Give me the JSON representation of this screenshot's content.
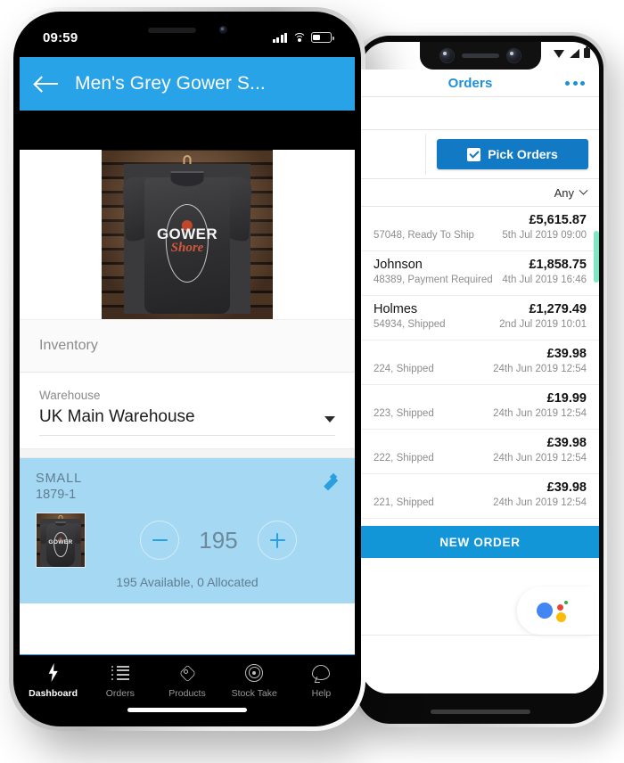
{
  "front_phone": {
    "status_bar": {
      "clock": "09:59",
      "signal": "signal-bars",
      "wifi": "wifi-icon",
      "battery": "battery-icon"
    },
    "header": {
      "back": "back-arrow",
      "title": "Men's Grey Gower S..."
    },
    "product_image": {
      "alt": "Men's Grey Gower Shore T-Shirt on hanger against wooden planks",
      "graphic_word": "GOWER",
      "graphic_script": "Shore"
    },
    "inventory": {
      "section_label": "Inventory"
    },
    "warehouse": {
      "caption": "Warehouse",
      "value": "UK Main Warehouse",
      "chevron": "chevron-down-icon"
    },
    "stock_card": {
      "size": "SMALL",
      "sku": "1879-1",
      "edit": "edit-pencil-icon",
      "decrement": "minus-icon",
      "quantity": "195",
      "increment": "plus-icon",
      "availability": "195 Available, 0 Allocated",
      "bg_color": "#a5d8f3"
    },
    "tabbar": {
      "items": [
        {
          "label": "Dashboard",
          "icon": "bolt-icon",
          "active": true
        },
        {
          "label": "Orders",
          "icon": "list-icon",
          "active": false
        },
        {
          "label": "Products",
          "icon": "tag-icon",
          "active": false
        },
        {
          "label": "Stock Take",
          "icon": "target-icon",
          "active": false
        },
        {
          "label": "Help",
          "icon": "chat-icon",
          "active": false
        }
      ]
    },
    "accent_color": "#29a3e8"
  },
  "back_phone": {
    "status_bar": {
      "wifi": "wifi-icon",
      "signal": "signal-icon",
      "battery": "battery-icon"
    },
    "header": {
      "title": "Orders",
      "overflow": "overflow-menu-icon"
    },
    "pick_orders": {
      "label": "Pick Orders",
      "icon": "clipboard-check-icon",
      "color": "#1279c4"
    },
    "filter": {
      "value": "Any",
      "chevron": "chevron-down-icon"
    },
    "orders": [
      {
        "name": "",
        "sub": "57048, Ready To Ship",
        "amount": "£5,615.87",
        "date": "5th Jul 2019 09:00"
      },
      {
        "name": "Johnson",
        "sub": "48389, Payment Required",
        "amount": "£1,858.75",
        "date": "4th Jul 2019 16:46"
      },
      {
        "name": "Holmes",
        "sub": "54934, Shipped",
        "amount": "£1,279.49",
        "date": "2nd Jul 2019 10:01"
      },
      {
        "name": "",
        "sub": "224, Shipped",
        "amount": "£39.98",
        "date": "24th Jun 2019 12:54"
      },
      {
        "name": "",
        "sub": "223, Shipped",
        "amount": "£19.99",
        "date": "24th Jun 2019 12:54"
      },
      {
        "name": "",
        "sub": "222, Shipped",
        "amount": "£39.98",
        "date": "24th Jun 2019 12:54"
      },
      {
        "name": "",
        "sub": "221, Shipped",
        "amount": "£39.98",
        "date": "24th Jun 2019 12:54"
      }
    ],
    "new_order": {
      "label": "NEW ORDER",
      "color": "#1296d8"
    },
    "assistant": {
      "icon": "google-assistant-icon"
    },
    "scroll_indicator_color": "#7fe7c4",
    "accent_color": "#1e90d8"
  }
}
